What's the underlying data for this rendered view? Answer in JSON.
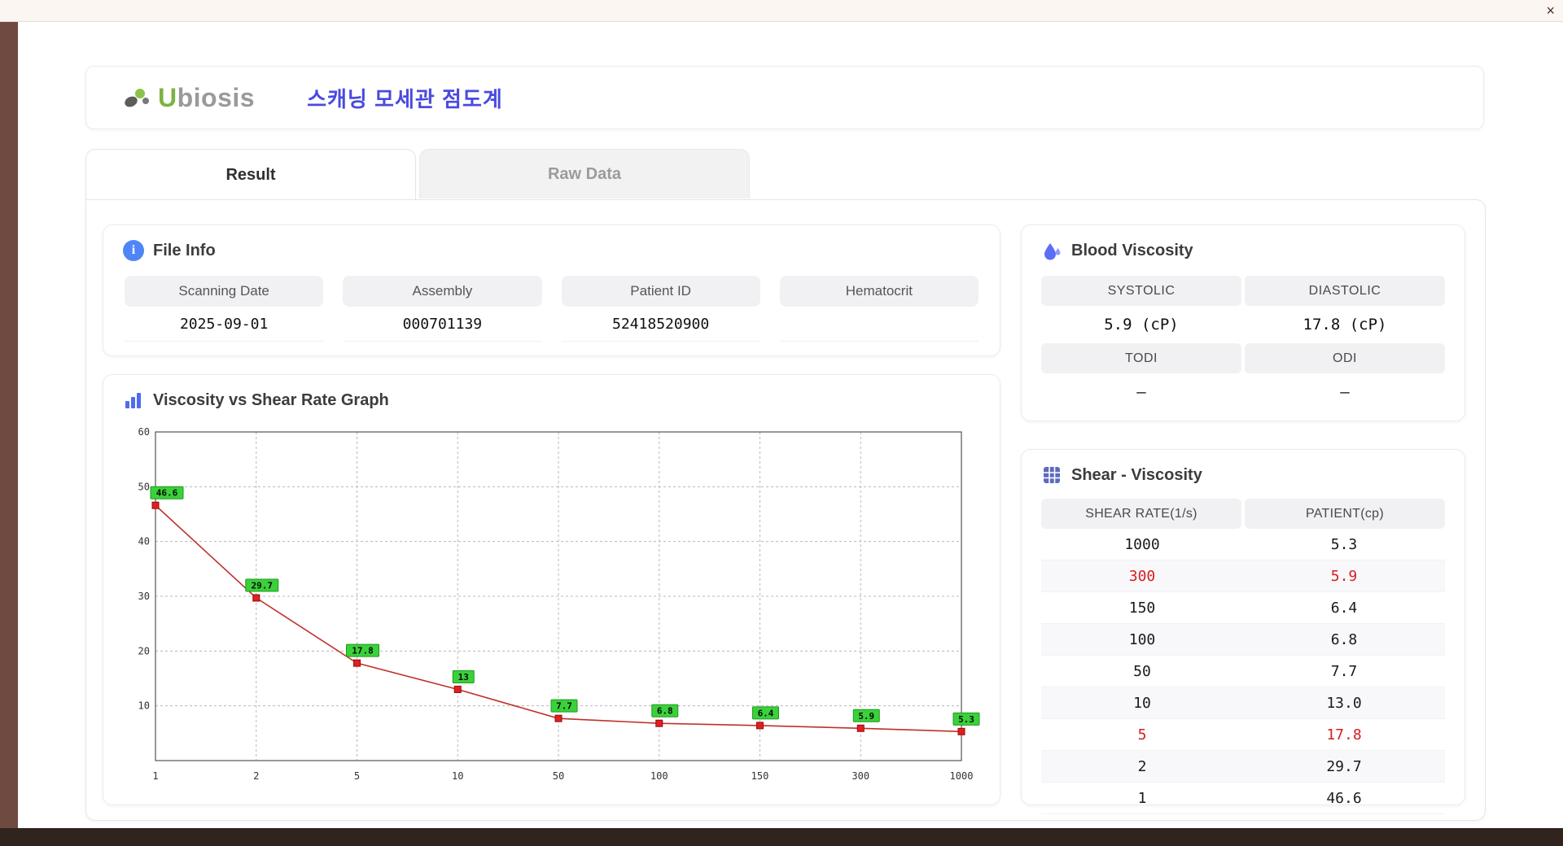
{
  "window": {
    "close_label": "×"
  },
  "header": {
    "logo_accent": "U",
    "logo_rest": "biosis",
    "title": "스캐닝 모세관 점도계"
  },
  "tabs": [
    {
      "label": "Result",
      "active": true
    },
    {
      "label": "Raw Data",
      "active": false
    }
  ],
  "file_info": {
    "title": "File Info",
    "fields": [
      {
        "label": "Scanning Date",
        "value": "2025-09-01"
      },
      {
        "label": "Assembly",
        "value": "000701139"
      },
      {
        "label": "Patient ID",
        "value": "52418520900"
      },
      {
        "label": "Hematocrit",
        "value": ""
      }
    ]
  },
  "blood_viscosity": {
    "title": "Blood Viscosity",
    "cells": [
      {
        "label": "SYSTOLIC",
        "value": "5.9 (cP)"
      },
      {
        "label": "DIASTOLIC",
        "value": "17.8 (cP)"
      },
      {
        "label": "TODI",
        "value": "–"
      },
      {
        "label": "ODI",
        "value": "–"
      }
    ]
  },
  "shear_viscosity": {
    "title": "Shear - Viscosity",
    "columns": [
      "SHEAR RATE(1/s)",
      "PATIENT(cp)"
    ],
    "rows": [
      {
        "shear": "1000",
        "patient": "5.3",
        "highlight": false
      },
      {
        "shear": "300",
        "patient": "5.9",
        "highlight": true
      },
      {
        "shear": "150",
        "patient": "6.4",
        "highlight": false
      },
      {
        "shear": "100",
        "patient": "6.8",
        "highlight": false
      },
      {
        "shear": "50",
        "patient": "7.7",
        "highlight": false
      },
      {
        "shear": "10",
        "patient": "13.0",
        "highlight": false
      },
      {
        "shear": "5",
        "patient": "17.8",
        "highlight": true
      },
      {
        "shear": "2",
        "patient": "29.7",
        "highlight": false
      },
      {
        "shear": "1",
        "patient": "46.6",
        "highlight": false
      }
    ]
  },
  "chart_data": {
    "type": "line",
    "title": "Viscosity vs Shear Rate Graph",
    "x_tick_labels": [
      "1",
      "2",
      "5",
      "10",
      "50",
      "100",
      "150",
      "300",
      "1000"
    ],
    "x": [
      1,
      2,
      5,
      10,
      50,
      100,
      150,
      300,
      1000
    ],
    "values": [
      46.6,
      29.7,
      17.8,
      13,
      7.7,
      6.8,
      6.4,
      5.9,
      5.3
    ],
    "labels": [
      "46.6",
      "29.7",
      "17.8",
      "13",
      "7.7",
      "6.8",
      "6.4",
      "5.9",
      "5.3"
    ],
    "xlabel": "",
    "ylabel": "",
    "ylim": [
      0,
      60
    ],
    "yticks": [
      10,
      20,
      30,
      40,
      50,
      60
    ],
    "grid": true,
    "legend": "none",
    "line_color": "#c03028",
    "marker_color": "#e41e1e",
    "label_bg": "#3ad13a"
  }
}
